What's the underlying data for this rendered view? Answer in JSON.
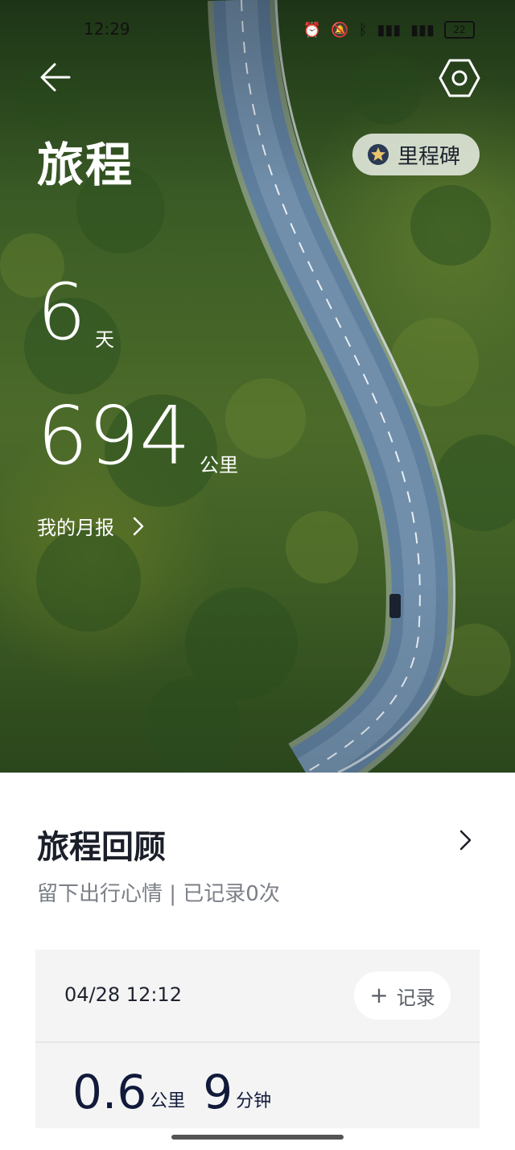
{
  "status_bar": {
    "time": "12:29",
    "battery": "22",
    "icons": [
      "alarm-icon",
      "mute-icon",
      "bluetooth-icon",
      "signal-icon",
      "signal-icon"
    ]
  },
  "header": {
    "title": "旅程",
    "milestone_label": "里程碑"
  },
  "stats": {
    "days_value": "6",
    "days_unit": "天",
    "distance_value": "694",
    "distance_unit": "公里"
  },
  "monthly_report": {
    "label": "我的月报"
  },
  "review": {
    "title": "旅程回顾",
    "subtitle": "留下出行心情 | 已记录0次"
  },
  "trip_card": {
    "datetime": "04/28 12:12",
    "record_label": "记录",
    "distance_value": "0.6",
    "distance_unit": "公里",
    "duration_value": "9",
    "duration_unit": "分钟"
  },
  "colors": {
    "accent_dark": "#1b1f29",
    "muted_text": "#7b7f87",
    "card_bg": "#f4f4f4",
    "milestone_star": "#2a3a55"
  }
}
